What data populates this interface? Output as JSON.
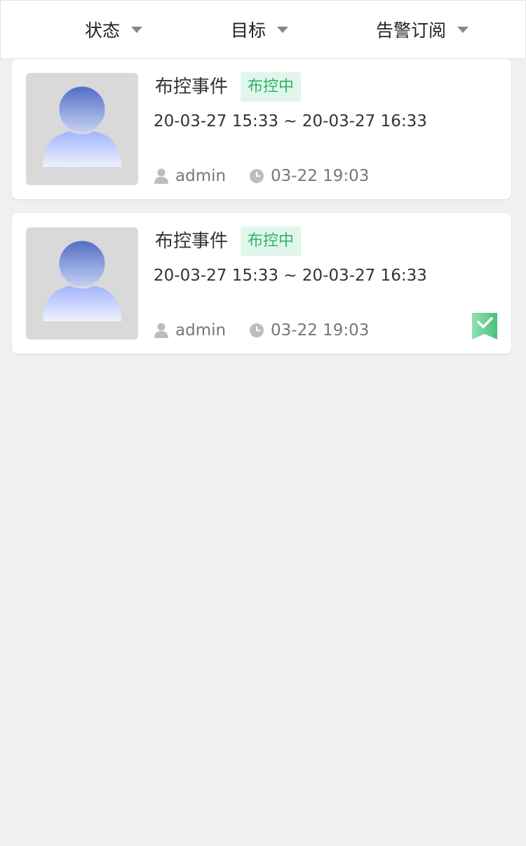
{
  "filters": [
    {
      "label": "状态"
    },
    {
      "label": "目标"
    },
    {
      "label": "告警订阅"
    }
  ],
  "events": [
    {
      "title": "布控事件",
      "status": "布控中",
      "time_range": "20-03-27 15:33 ~ 20-03-27 16:33",
      "user": "admin",
      "created": "03-22 19:03",
      "subscribed": false
    },
    {
      "title": "布控事件",
      "status": "布控中",
      "time_range": "20-03-27 15:33 ~ 20-03-27 16:33",
      "user": "admin",
      "created": "03-22 19:03",
      "subscribed": true
    }
  ],
  "icons": {
    "avatar": "person-avatar-icon",
    "user": "user-icon",
    "clock": "clock-icon",
    "bookmark": "bookmark-check-icon",
    "caret": "caret-down-icon"
  },
  "colors": {
    "status_bg": "#e1f6ea",
    "status_text": "#2fb36a",
    "bookmark": "#5cc98a",
    "page_bg": "#f0f0f0"
  }
}
